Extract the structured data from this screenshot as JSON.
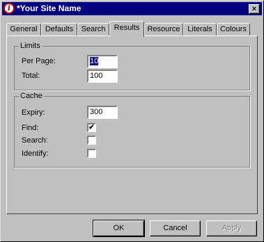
{
  "window": {
    "title": "*Your Site Name",
    "icon": "info-icon",
    "close_label": "×"
  },
  "tabs": [
    {
      "label": "General"
    },
    {
      "label": "Defaults"
    },
    {
      "label": "Search"
    },
    {
      "label": "Results",
      "active": true
    },
    {
      "label": "Resource"
    },
    {
      "label": "Literals"
    },
    {
      "label": "Colours"
    }
  ],
  "limits": {
    "title": "Limits",
    "per_page_label": "Per Page:",
    "per_page_value": "10",
    "total_label": "Total:",
    "total_value": "100"
  },
  "cache": {
    "title": "Cache",
    "expiry_label": "Expiry:",
    "expiry_value": "300",
    "find_label": "Find:",
    "find_checked": true,
    "search_label": "Search:",
    "search_checked": false,
    "identify_label": "Identify:",
    "identify_checked": false,
    "check_glyph": "✔"
  },
  "buttons": {
    "ok": "OK",
    "cancel": "Cancel",
    "apply": "Apply"
  }
}
